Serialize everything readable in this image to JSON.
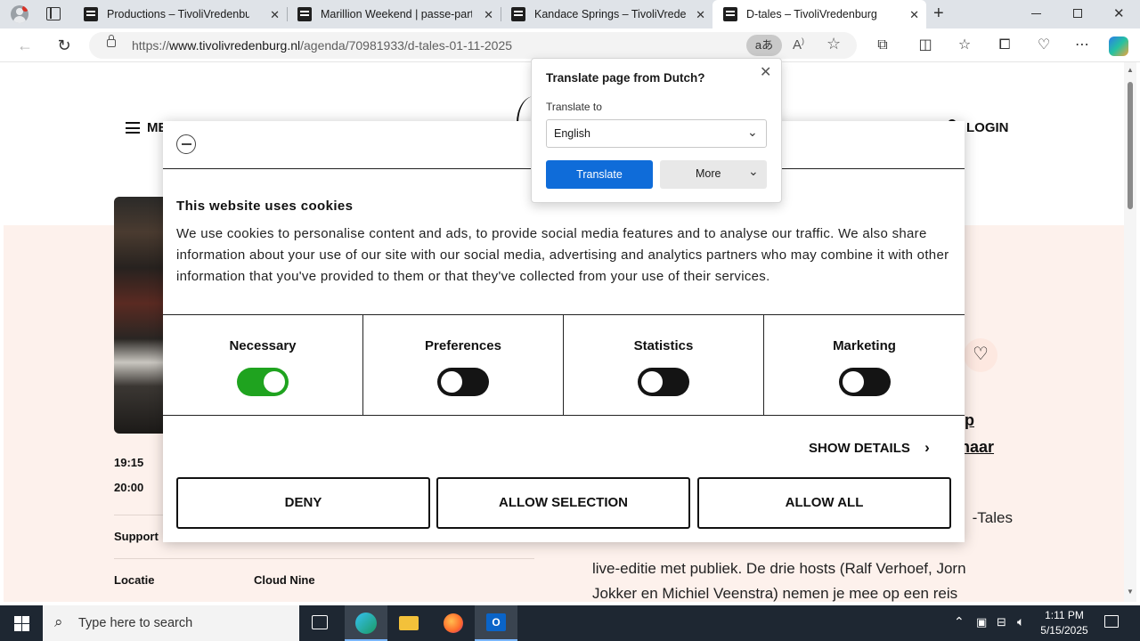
{
  "browser": {
    "tabs": [
      {
        "title": "Productions – TivoliVredenburg",
        "active": false
      },
      {
        "title": "Marillion Weekend | passe-partout",
        "active": false
      },
      {
        "title": "Kandace Springs – TivoliVredenburg",
        "active": false
      },
      {
        "title": "D-tales – TivoliVredenburg",
        "active": true
      }
    ],
    "url_prefix": "https://",
    "url_domain": "www.tivolivredenburg.nl",
    "url_path": "/agenda/70981933/d-tales-01-11-2025",
    "read_aloud_label": "Â"
  },
  "site": {
    "menu_label": "ME",
    "login_label": "LOGIN",
    "times": [
      "19:15",
      "20:00"
    ],
    "support_label": "Support",
    "locatie_label": "Locatie",
    "locatie_value": "Cloud Nine",
    "link_fragment_1": "p",
    "link_fragment_2": "naar",
    "body_lines": [
      "-Tales",
      "live-editie met publiek. De drie hosts (Ralf Verhoef, Jorn",
      "Jokker en Michiel Veenstra) nemen je mee op een reis"
    ]
  },
  "cookie": {
    "title": "This website uses cookies",
    "text": "We use cookies to personalise content and ads, to provide social media features and to analyse our traffic. We also share information about your use of our site with our social media, advertising and analytics partners who may combine it with other information that you've provided to them or that they've collected from your use of their services.",
    "categories": [
      {
        "label": "Necessary",
        "enabled": true
      },
      {
        "label": "Preferences",
        "enabled": false
      },
      {
        "label": "Statistics",
        "enabled": false
      },
      {
        "label": "Marketing",
        "enabled": false
      }
    ],
    "show_details": "SHOW DETAILS",
    "deny": "DENY",
    "allow_selection": "ALLOW SELECTION",
    "allow_all": "ALLOW ALL"
  },
  "translate": {
    "title": "Translate page from Dutch?",
    "to_label": "Translate to",
    "language": "English",
    "translate_button": "Translate",
    "more_button": "More"
  },
  "taskbar": {
    "search_placeholder": "Type here to search",
    "time": "1:11 PM",
    "date": "5/15/2025"
  },
  "colors": {
    "accent_blue": "#0f6cd9",
    "toggle_on": "#1fa31f",
    "peach_bg": "#fdf1ec"
  }
}
